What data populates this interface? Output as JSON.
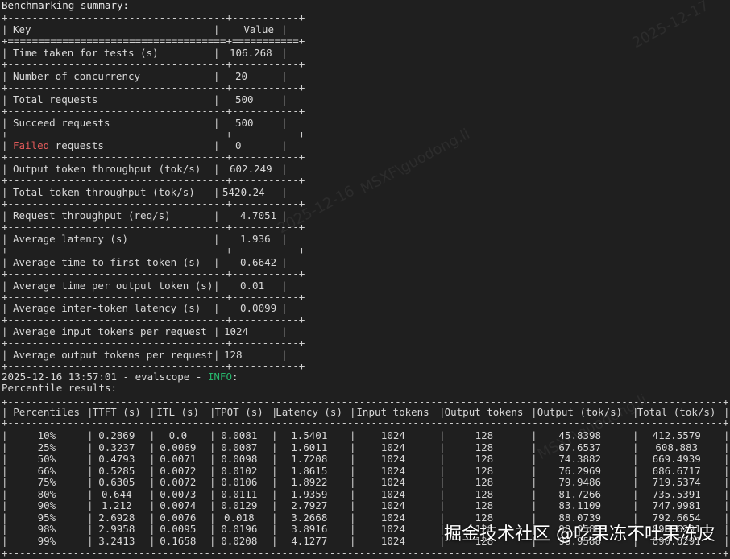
{
  "title": "Benchmarking summary:",
  "summary": {
    "key_header": "Key",
    "value_header": "Value",
    "rows": [
      {
        "key": "Time taken for tests (s)",
        "value": "106.268"
      },
      {
        "key": "Number of concurrency",
        "value": "20"
      },
      {
        "key": "Total requests",
        "value": "500"
      },
      {
        "key": "Succeed requests",
        "value": "500"
      },
      {
        "key_prefix": "Failed",
        "key": " requests",
        "value": "0"
      },
      {
        "key": "Output token throughput (tok/s)",
        "value": "602.249"
      },
      {
        "key": "Total token throughput (tok/s)",
        "value": "5420.24"
      },
      {
        "key": "Request throughput (req/s)",
        "value": "4.7051"
      },
      {
        "key": "Average latency (s)",
        "value": "1.936"
      },
      {
        "key": "Average time to first token (s)",
        "value": "0.6642"
      },
      {
        "key": "Average time per output token (s)",
        "value": "0.01"
      },
      {
        "key": "Average inter-token latency (s)",
        "value": "0.0099"
      },
      {
        "key": "Average input tokens per request",
        "value": "1024"
      },
      {
        "key": "Average output tokens per request",
        "value": "128"
      }
    ]
  },
  "log": {
    "prefix": "2025-12-16 13:57:01 - evalscope - ",
    "level": "INFO",
    "suffix": ":"
  },
  "percentile_title": "Percentile results:",
  "percentile": {
    "headers": [
      "Percentiles",
      "TTFT (s)",
      "ITL (s)",
      "TPOT (s)",
      "Latency (s)",
      "Input tokens",
      "Output tokens",
      "Output (tok/s)",
      "Total (tok/s)"
    ],
    "rows": [
      [
        "10%",
        "0.2869",
        "0.0",
        "0.0081",
        "1.5401",
        "1024",
        "128",
        "45.8398",
        "412.5579"
      ],
      [
        "25%",
        "0.3237",
        "0.0069",
        "0.0087",
        "1.6011",
        "1024",
        "128",
        "67.6537",
        "608.883"
      ],
      [
        "50%",
        "0.4793",
        "0.0071",
        "0.0098",
        "1.7208",
        "1024",
        "128",
        "74.3882",
        "669.4939"
      ],
      [
        "66%",
        "0.5285",
        "0.0072",
        "0.0102",
        "1.8615",
        "1024",
        "128",
        "76.2969",
        "686.6717"
      ],
      [
        "75%",
        "0.6305",
        "0.0072",
        "0.0106",
        "1.8922",
        "1024",
        "128",
        "79.9486",
        "719.5374"
      ],
      [
        "80%",
        "0.644",
        "0.0073",
        "0.0111",
        "1.9359",
        "1024",
        "128",
        "81.7266",
        "735.5391"
      ],
      [
        "90%",
        "1.212",
        "0.0074",
        "0.0129",
        "2.7927",
        "1024",
        "128",
        "83.1109",
        "747.9981"
      ],
      [
        "95%",
        "2.6928",
        "0.0076",
        "0.018",
        "3.2668",
        "1024",
        "128",
        "88.0739",
        "792.6654"
      ],
      [
        "98%",
        "2.9958",
        "0.0095",
        "0.0196",
        "3.8916",
        "1024",
        "128",
        "98.9588",
        "890.6291"
      ],
      [
        "99%",
        "3.2413",
        "0.1658",
        "0.0208",
        "4.1277",
        "1024",
        "128",
        "98.9588",
        "890.6291"
      ]
    ]
  },
  "watermarks": [
    "MSXF\\guodong.li",
    "2025-12-16",
    "2025-12-17"
  ],
  "site_watermark": "掘金技术社区 @吃果冻不吐果冻皮"
}
